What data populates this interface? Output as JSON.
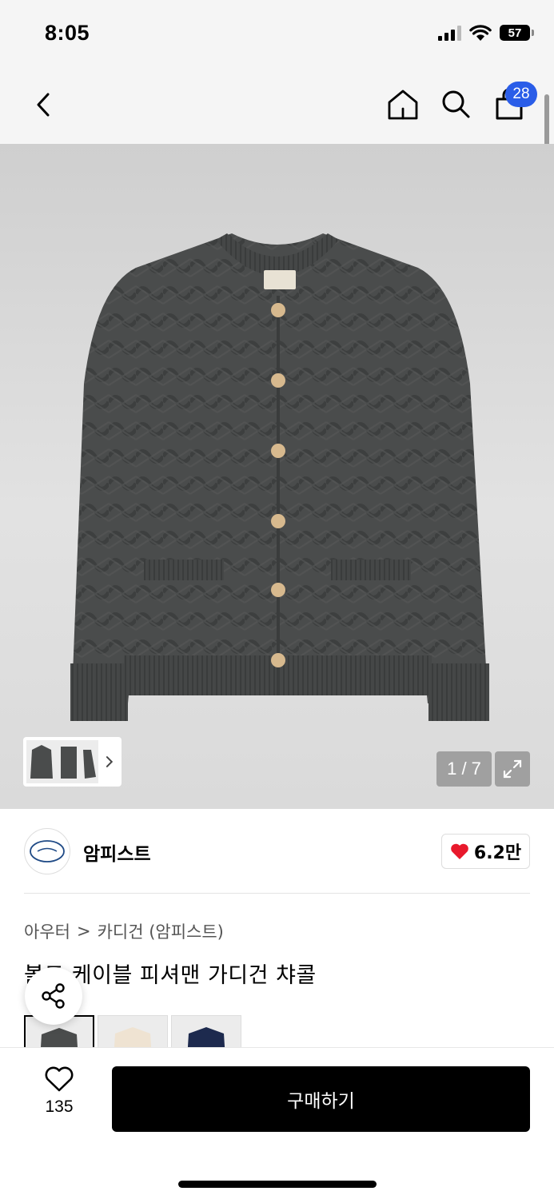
{
  "status_bar": {
    "time": "8:05",
    "battery": "57"
  },
  "nav": {
    "cart_count": "28"
  },
  "product_image": {
    "pager_text": "1 / 7"
  },
  "brand": {
    "name": "암피스트",
    "likes": "6.2만"
  },
  "breadcrumb": {
    "level1": "아우터",
    "separator": ">",
    "level2": "카디건 (암피스트)"
  },
  "product": {
    "title": "볼드 케이블 피셔맨 가디건 챠콜"
  },
  "color_options": [
    "charcoal",
    "ivory",
    "navy"
  ],
  "bottom_bar": {
    "wish_count": "135",
    "buy_label": "구매하기"
  },
  "colors": {
    "accent": "#2a5de8",
    "heart": "#e8192c",
    "primary": "#000000",
    "sweater": "#4a4c4c",
    "button": "#d7b98e"
  },
  "icons": [
    "back-icon",
    "home-icon",
    "search-icon",
    "shopping-bag-icon",
    "expand-icon",
    "chevron-right-icon",
    "share-icon",
    "heart-icon"
  ]
}
